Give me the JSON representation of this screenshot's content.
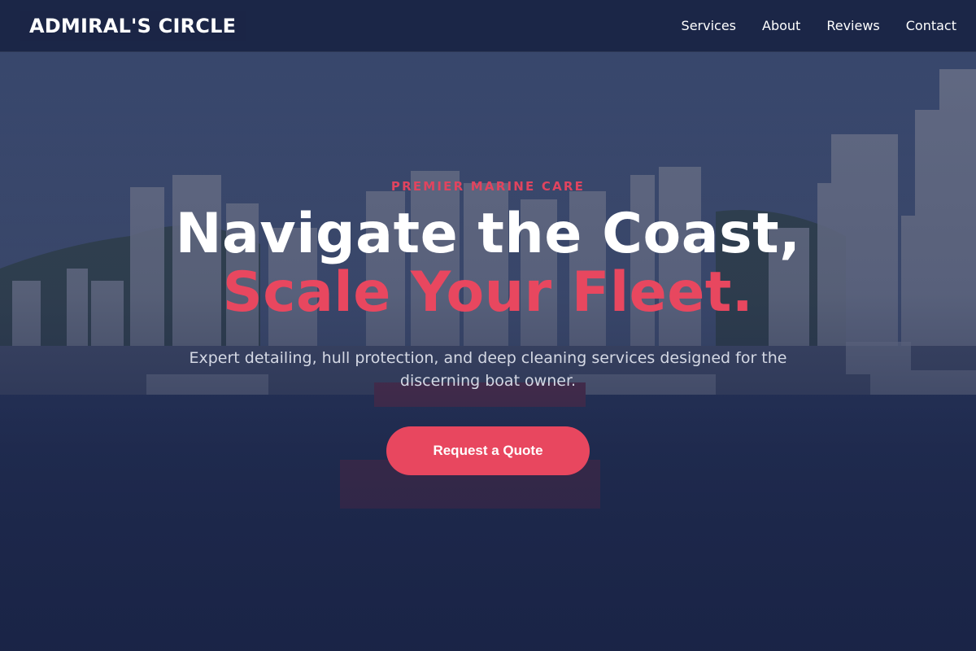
{
  "brand": {
    "name": "ADMIRAL'S CIRCLE"
  },
  "nav": {
    "links": [
      "Services",
      "About",
      "Reviews",
      "Contact"
    ]
  },
  "hero": {
    "eyebrow": "PREMIER MARINE CARE",
    "headline_line1": "Navigate the Coast,",
    "headline_line2": "Scale Your Fleet.",
    "subtext": "Expert detailing, hull protection, and deep cleaning services designed for the discerning boat owner.",
    "cta_label": "Request a Quote"
  },
  "colors": {
    "navy": "#1a2447",
    "accent": "#e8475f",
    "text": "#ffffff"
  }
}
